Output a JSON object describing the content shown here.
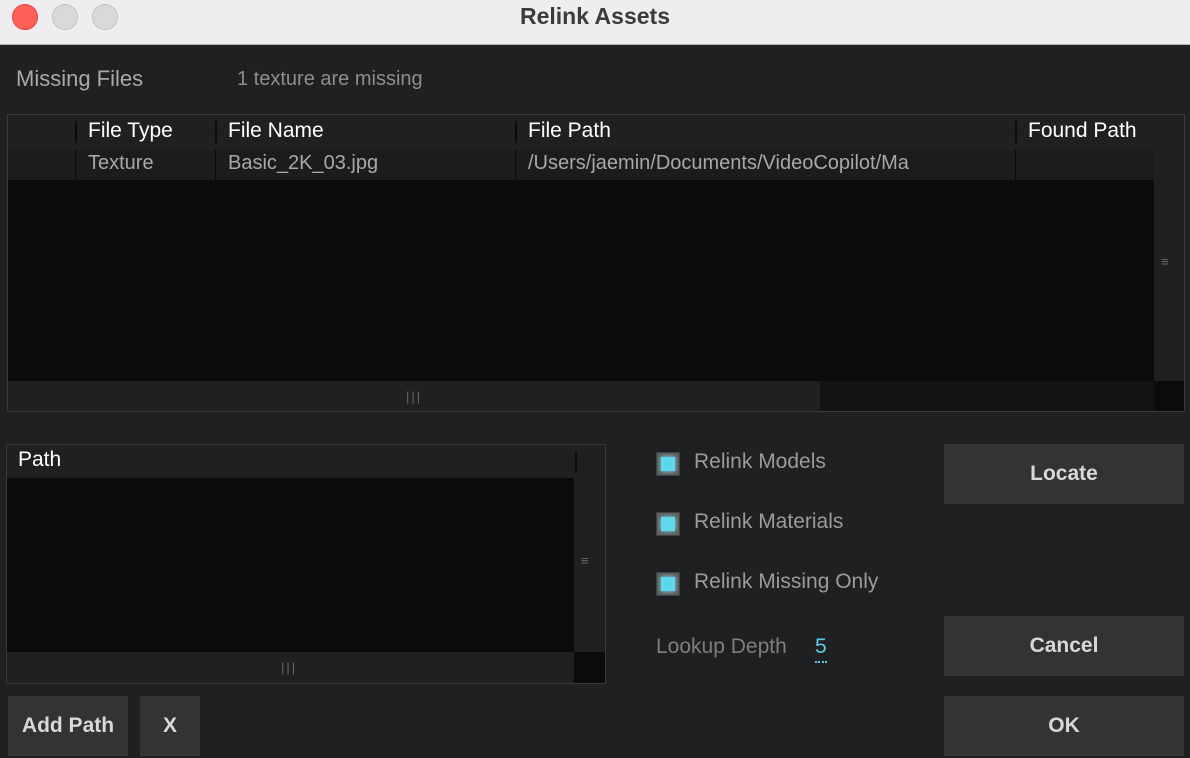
{
  "window": {
    "title": "Relink Assets"
  },
  "missing": {
    "label": "Missing Files",
    "count_text": "1 texture are missing"
  },
  "files_table": {
    "columns": [
      "File Type",
      "File Name",
      "File Path",
      "Found Path"
    ],
    "rows": [
      {
        "type": "Texture",
        "name": "Basic_2K_03.jpg",
        "path": "/Users/jaemin/Documents/VideoCopilot/Ma",
        "found": ""
      }
    ]
  },
  "path_table": {
    "header": "Path"
  },
  "options": {
    "relink_models": {
      "label": "Relink Models",
      "checked": true
    },
    "relink_materials": {
      "label": "Relink Materials",
      "checked": true
    },
    "relink_missing_only": {
      "label": "Relink Missing Only",
      "checked": true
    },
    "lookup_depth": {
      "label": "Lookup Depth",
      "value": "5"
    }
  },
  "buttons": {
    "locate": "Locate",
    "cancel": "Cancel",
    "ok": "OK",
    "add_path": "Add Path",
    "remove": "X"
  },
  "icons": {
    "vertical_grip": "grip-lines-vertical-icon",
    "horizontal_grip": "grip-lines-horizontal-icon"
  },
  "colors": {
    "checkbox_accent": "#5ed9ec",
    "close_button": "#fe5f57",
    "background": "#1f2022"
  }
}
